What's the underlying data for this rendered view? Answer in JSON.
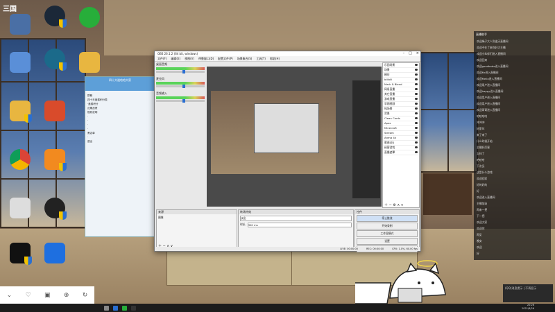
{
  "overlay": {
    "logo_text": "三国"
  },
  "desktop_icons": [
    {
      "label": "",
      "color": "#4a6fa5"
    },
    {
      "label": "",
      "color": "#1b2838"
    },
    {
      "label": "",
      "color": "#27ae3a"
    },
    {
      "label": "",
      "color": "#5a8fd8"
    },
    {
      "label": "",
      "color": "#1b6a8a"
    },
    {
      "label": "",
      "color": "#e8b640"
    },
    {
      "label": "",
      "color": "#e8b640"
    },
    {
      "label": "",
      "color": "#d94b2b"
    },
    {
      "label": "",
      "color": "#4285f4"
    },
    {
      "label": "",
      "color": "#f28a1f"
    },
    {
      "label": "",
      "color": "#ddd"
    },
    {
      "label": "",
      "color": "#222"
    },
    {
      "label": "",
      "color": "#111"
    },
    {
      "label": "",
      "color": "#1e6fe0"
    }
  ],
  "obs": {
    "title": "OBS 26.1.2 (64 bit, windows)",
    "menus": [
      "文件(F)",
      "编辑(E)",
      "视图(V)",
      "停靠窗口(D)",
      "配置文件(P)",
      "场景集合(S)",
      "工具(T)",
      "帮助(H)"
    ],
    "mixer_channels": [
      {
        "name": "桌面音频"
      },
      {
        "name": "麦克风"
      },
      {
        "name": "音频输入"
      }
    ],
    "scenes": [
      "乐园场景",
      "场景",
      "模仿",
      "bilibili",
      "Mark & Blend",
      "网易直播",
      "其它直播",
      "游戏直播",
      "早期视频",
      "纯场景",
      "背景",
      "Clean Cards",
      "Apex",
      "Minecraft",
      "Stream",
      "Arena 4k",
      "歌曲(旧)",
      "经营游戏",
      "直播遮罩"
    ],
    "panels": {
      "sources": "来源",
      "transitions": "转场特效",
      "controls": "控件"
    },
    "transition_value": "淡出",
    "duration_label": "时长",
    "duration_value": "300 ms",
    "sources_item": "图像",
    "controls_buttons": [
      "停止推流",
      "开始录制",
      "工作室模式",
      "设置",
      "退出"
    ],
    "status": [
      "LIVE: 00:00:00",
      "REC: 00:00:00",
      "CPU: 1.0%, 60.00 fps"
    ]
  },
  "qq": {
    "title": "四十大道哈哈大家",
    "rows": [
      "群聊",
      "四十天盖楼积分表",
      "·盖楼积分",
      "近期战绩",
      "规则说明",
      "·",
      "·",
      "·",
      "·",
      "黑名单",
      "·",
      "退出"
    ]
  },
  "chat": {
    "header": "直播助手",
    "lines": [
      "欢迎绳子大人到逆天直播间",
      "欢迎不在了来你好大主播",
      "欢迎小伙伴们进入直播间",
      "欢迎回来",
      "欢迎goodbabe进入直播间",
      "欢迎Mr进入直播间",
      "欢迎Mello进入直播间",
      "欢迎用户进入直播间",
      "欢迎happy进入直播间",
      "欢迎用户进入直播间",
      "欢迎用户进入直播间",
      "欢迎哥哥进入直播间",
      "哈哈哈哈",
      "冲冲冲",
      "好家伙",
      "来了来了",
      "什么时候开始",
      "主播好厉害",
      "太帅了",
      "哈哈哈",
      "下次见",
      "这是什么游戏",
      "欢迎回家",
      "好的好的",
      "好",
      "欢迎进入直播间",
      "主播加油",
      "再来一把",
      "下一把",
      "欢迎大家",
      "欢迎你",
      "再见",
      "晚安",
      "欢迎",
      "好"
    ]
  },
  "taskbar": {
    "time": "20:26",
    "date": "2021/8/26"
  },
  "notification": {
    "text": "(QQ)消息提示 | 不再显示"
  },
  "bottom_toolbar": {
    "icons": [
      "chevron-down",
      "heart",
      "shop",
      "gift",
      "refresh"
    ]
  }
}
